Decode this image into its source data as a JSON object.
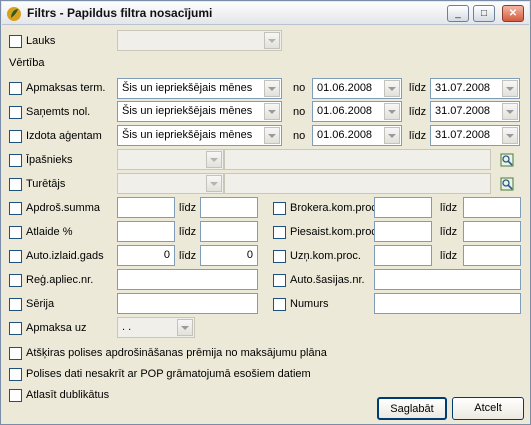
{
  "window": {
    "title": "Filtrs - Papildus filtra nosacījumi",
    "min_symbol": "_",
    "max_symbol": "□",
    "close_symbol": "✕"
  },
  "lauks": {
    "label": "Lauks",
    "value": ""
  },
  "vertiba": {
    "label": "Vērtība"
  },
  "date_rows": [
    {
      "label": "Apmaksas term.",
      "period": "Šis un iepriekšējais mēnes",
      "from_word": "no",
      "from": "01.06.2008",
      "to_word": "līdz",
      "to": "31.07.2008"
    },
    {
      "label": "Saņemts nol.",
      "period": "Šis un iepriekšējais mēnes",
      "from_word": "no",
      "from": "01.06.2008",
      "to_word": "līdz",
      "to": "31.07.2008"
    },
    {
      "label": "Izdota aģentam",
      "period": "Šis un iepriekšējais mēnes",
      "from_word": "no",
      "from": "01.06.2008",
      "to_word": "līdz",
      "to": "31.07.2008"
    }
  ],
  "ipasnieks": {
    "label": "Īpašnieks",
    "code": "",
    "name": ""
  },
  "turetajs": {
    "label": "Turētājs",
    "code": "",
    "name": ""
  },
  "ranges_left": [
    {
      "label": "Apdroš.summa",
      "from": "",
      "to_word": "līdz",
      "to": ""
    },
    {
      "label": "Atlaide %",
      "from": "",
      "to_word": "līdz",
      "to": ""
    },
    {
      "label": "Auto.izlaid.gads",
      "from": "0",
      "to_word": "līdz",
      "to": "0"
    }
  ],
  "ranges_right": [
    {
      "label": "Brokera.kom.proc.",
      "from": "",
      "to_word": "līdz",
      "to": ""
    },
    {
      "label": "Piesaist.kom.proc.",
      "from": "",
      "to_word": "līdz",
      "to": ""
    },
    {
      "label": "Uzņ.kom.proc.",
      "from": "",
      "to_word": "līdz",
      "to": ""
    }
  ],
  "reg_apliec": {
    "label": "Reģ.apliec.nr.",
    "value": ""
  },
  "auto_sasijas": {
    "label": "Auto.šasijas.nr.",
    "value": ""
  },
  "serija": {
    "label": "Sērija",
    "value": ""
  },
  "numurs": {
    "label": "Numurs",
    "value": ""
  },
  "apmaksa_uz": {
    "label": "Apmaksa uz",
    "value": " .  ."
  },
  "options": [
    "Atšķiras polises apdrošināšanas prēmija no maksājumu plāna",
    "Polises dati nesakrīt ar POP grāmatojumā esošiem datiem",
    "Atlasīt dublikātus"
  ],
  "buttons": {
    "save": "Saglabāt",
    "cancel": "Atcelt"
  }
}
